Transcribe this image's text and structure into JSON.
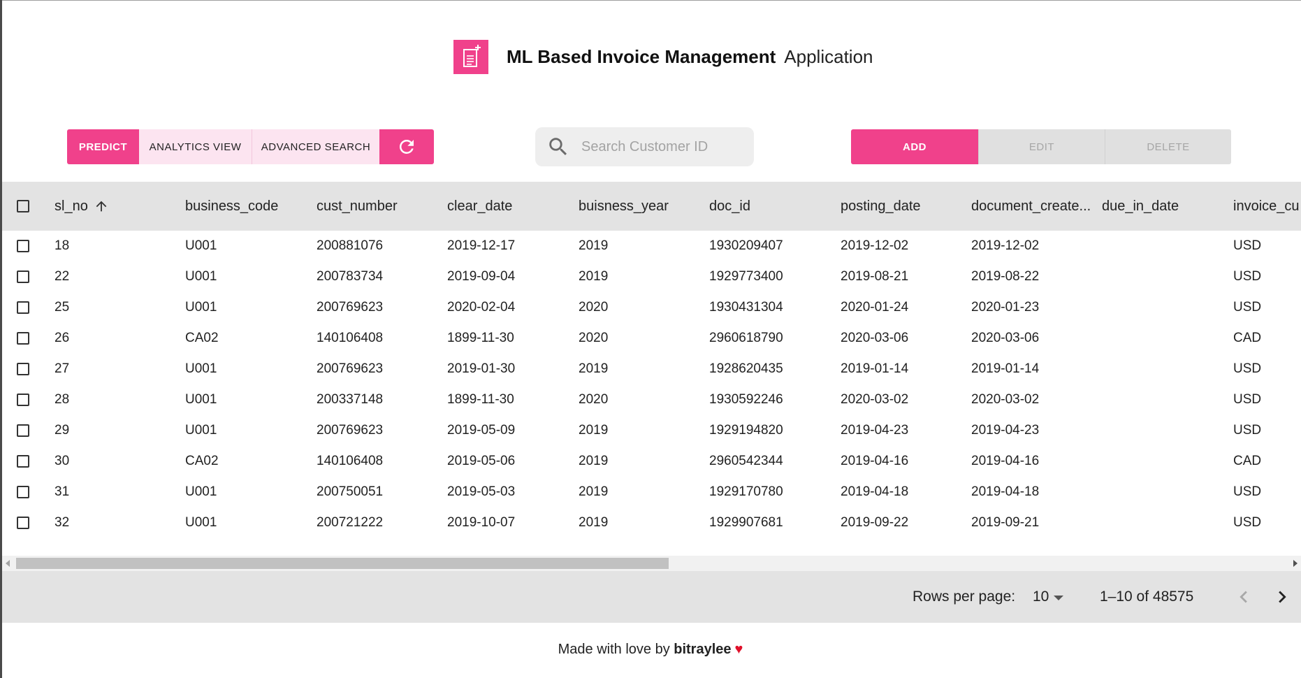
{
  "header": {
    "title_strong": "ML Based Invoice Management",
    "title_light": "Application",
    "logo_icon": "invoice-add-icon"
  },
  "toolbar": {
    "predict_label": "PREDICT",
    "analytics_label": "ANALYTICS VIEW",
    "advanced_search_label": "ADVANCED SEARCH",
    "refresh_icon": "refresh-icon",
    "search_placeholder": "Search Customer ID",
    "add_label": "ADD",
    "edit_label": "EDIT",
    "delete_label": "DELETE"
  },
  "colors": {
    "accent": "#f0418b",
    "accent_light": "#fce4f0",
    "disabled_bg": "#e0e0e0",
    "grid_header_bg": "#e3e3e3"
  },
  "grid": {
    "columns": [
      "sl_no",
      "business_code",
      "cust_number",
      "clear_date",
      "buisness_year",
      "doc_id",
      "posting_date",
      "document_create...",
      "due_in_date",
      "invoice_cu"
    ],
    "sort_column": "sl_no",
    "sort_direction": "ascending",
    "rows": [
      [
        "18",
        "U001",
        "200881076",
        "2019-12-17",
        "2019",
        "1930209407",
        "2019-12-02",
        "2019-12-02",
        "",
        "USD"
      ],
      [
        "22",
        "U001",
        "200783734",
        "2019-09-04",
        "2019",
        "1929773400",
        "2019-08-21",
        "2019-08-22",
        "",
        "USD"
      ],
      [
        "25",
        "U001",
        "200769623",
        "2020-02-04",
        "2020",
        "1930431304",
        "2020-01-24",
        "2020-01-23",
        "",
        "USD"
      ],
      [
        "26",
        "CA02",
        "140106408",
        "1899-11-30",
        "2020",
        "2960618790",
        "2020-03-06",
        "2020-03-06",
        "",
        "CAD"
      ],
      [
        "27",
        "U001",
        "200769623",
        "2019-01-30",
        "2019",
        "1928620435",
        "2019-01-14",
        "2019-01-14",
        "",
        "USD"
      ],
      [
        "28",
        "U001",
        "200337148",
        "1899-11-30",
        "2020",
        "1930592246",
        "2020-03-02",
        "2020-03-02",
        "",
        "USD"
      ],
      [
        "29",
        "U001",
        "200769623",
        "2019-05-09",
        "2019",
        "1929194820",
        "2019-04-23",
        "2019-04-23",
        "",
        "USD"
      ],
      [
        "30",
        "CA02",
        "140106408",
        "2019-05-06",
        "2019",
        "2960542344",
        "2019-04-16",
        "2019-04-16",
        "",
        "CAD"
      ],
      [
        "31",
        "U001",
        "200750051",
        "2019-05-03",
        "2019",
        "1929170780",
        "2019-04-18",
        "2019-04-18",
        "",
        "USD"
      ],
      [
        "32",
        "U001",
        "200721222",
        "2019-10-07",
        "2019",
        "1929907681",
        "2019-09-22",
        "2019-09-21",
        "",
        "USD"
      ]
    ]
  },
  "pagination": {
    "rows_per_page_label": "Rows per page:",
    "rows_per_page_value": "10",
    "range_text": "1–10 of 48575"
  },
  "footer": {
    "prefix": "Made with love by",
    "author": "bitraylee",
    "heart": "♥"
  }
}
